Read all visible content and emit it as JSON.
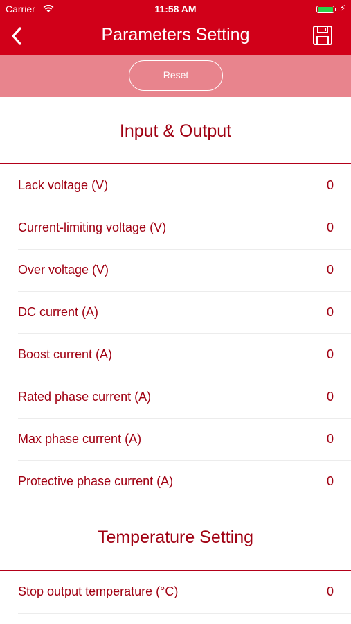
{
  "status": {
    "carrier": "Carrier",
    "time": "11:58 AM"
  },
  "nav": {
    "title": "Parameters Setting",
    "back_icon": "chevron-left-icon",
    "save_icon": "floppy-disk-icon"
  },
  "reset_label": "Reset",
  "colors": {
    "primary": "#d10019",
    "reset_band": "#e8848d",
    "text": "#a00012"
  },
  "sections": [
    {
      "title": "Input & Output",
      "rows": [
        {
          "label": "Lack voltage (V)",
          "value": "0"
        },
        {
          "label": "Current-limiting voltage (V)",
          "value": "0"
        },
        {
          "label": "Over voltage (V)",
          "value": "0"
        },
        {
          "label": "DC current (A)",
          "value": "0"
        },
        {
          "label": "Boost current (A)",
          "value": "0"
        },
        {
          "label": "Rated phase current (A)",
          "value": "0"
        },
        {
          "label": "Max phase current (A)",
          "value": "0"
        },
        {
          "label": "Protective phase current (A)",
          "value": "0"
        }
      ]
    },
    {
      "title": "Temperature Setting",
      "rows": [
        {
          "label": "Stop output temperature (°C)",
          "value": "0"
        }
      ]
    }
  ]
}
